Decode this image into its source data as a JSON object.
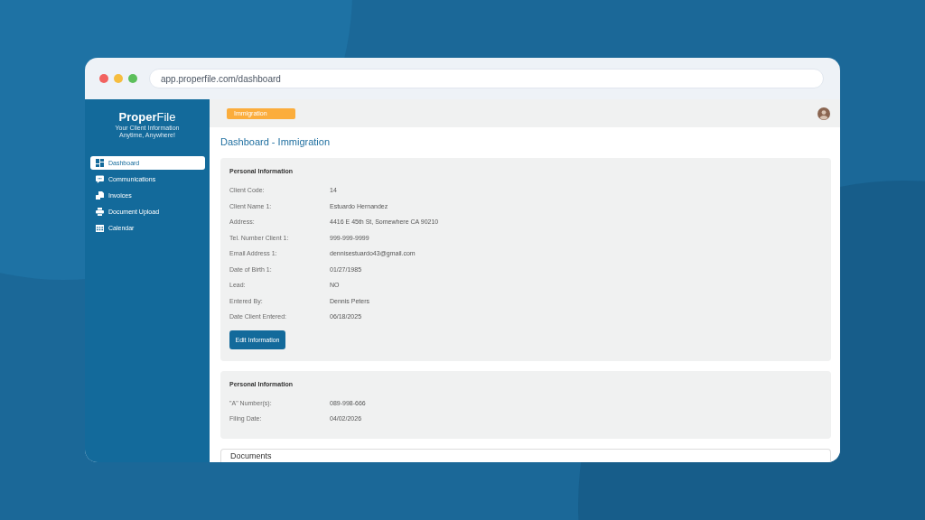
{
  "browser": {
    "url": "app.properfile.com/dashboard"
  },
  "sidebar": {
    "logo": "**Proper**File",
    "tagline": "Your Client Information Anytime, Anywhere!",
    "items": [
      {
        "label": "Dashboard",
        "selected": true
      },
      {
        "label": "Communications",
        "selected": false
      },
      {
        "label": "Invoices",
        "selected": false
      },
      {
        "label": "Document Upload",
        "selected": false
      },
      {
        "label": "Calendar",
        "selected": false
      }
    ]
  },
  "top_bar": {
    "badge": "Immigration"
  },
  "page_title": "Dashboard - Immigration",
  "sections": [
    {
      "title": "Personal Information",
      "fields": [
        {
          "label": "Client Code:",
          "value": "14"
        },
        {
          "label": "Client Name 1:",
          "value": "Estuardo Hernandez"
        },
        {
          "label": "Address:",
          "value": "4416 E 45th St, Somewhere CA 90210"
        },
        {
          "label": "Tel. Number Client 1:",
          "value": "999-999-9999"
        },
        {
          "label": "Email Address 1:",
          "value": "dennisestuardo43@gmail.com"
        },
        {
          "label": "Date of Birth 1:",
          "value": "01/27/1985"
        },
        {
          "label": "Lead:",
          "value": "NO"
        },
        {
          "label": "Entered By:",
          "value": "Dennis Peters"
        },
        {
          "label": "Date Client Entered:",
          "value": "06/18/2025"
        }
      ],
      "button": "Edit Information"
    },
    {
      "title": "Personal Information",
      "fields": [
        {
          "label": "\"A\" Number(s):",
          "value": "089-998-666"
        },
        {
          "label": "Filing Date:",
          "value": "04/02/2026"
        }
      ]
    }
  ],
  "documents": {
    "title": "Documents"
  }
}
